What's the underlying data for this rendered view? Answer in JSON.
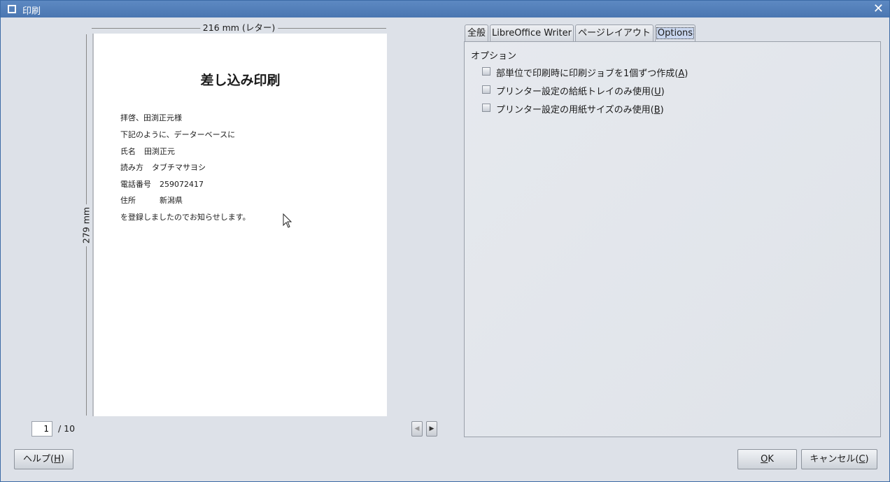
{
  "window": {
    "title": "印刷",
    "close_icon": "close-icon"
  },
  "preview": {
    "width_label": "216 mm (レター)",
    "height_label": "279 mm",
    "document": {
      "title": "差し込み印刷",
      "greeting_prefix": "拝啓、",
      "greeting_name": "田渕正元様",
      "line2": "下記のように、データーベースに",
      "name_label": "氏名",
      "name_value": "田渕正元",
      "reading_label": "読み方",
      "reading_value": "タブチマサヨシ",
      "phone_label": "電話番号",
      "phone_value": "259072417",
      "address_label": "住所",
      "address_value": "新潟県",
      "closing": "を登録しましたのでお知らせします。"
    },
    "page_number": "1",
    "page_total": "/ 10"
  },
  "tabs": [
    {
      "label": "全般"
    },
    {
      "label": "LibreOffice Writer"
    },
    {
      "label": "ページレイアウト"
    },
    {
      "label": "Options"
    }
  ],
  "options_panel": {
    "group_label": "オプション",
    "items": [
      {
        "text": "部単位で印刷時に印刷ジョブを1個ずつ作成(",
        "key": "A",
        "end": ")"
      },
      {
        "text": "プリンター設定の給紙トレイのみ使用(",
        "key": "U",
        "end": ")"
      },
      {
        "text": "プリンター設定の用紙サイズのみ使用(",
        "key": "B",
        "end": ")"
      }
    ]
  },
  "buttons": {
    "help": {
      "text": "ヘルプ(",
      "key": "H",
      "end": ")"
    },
    "ok": {
      "text": "",
      "key": "O",
      "end": "K"
    },
    "cancel": {
      "text": "キャンセル(",
      "key": "C",
      "end": ")"
    }
  }
}
